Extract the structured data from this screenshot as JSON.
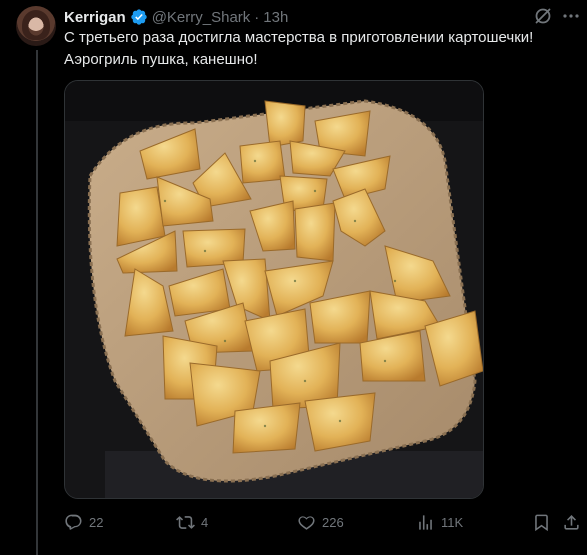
{
  "tweet": {
    "author_name": "Kerrigan",
    "author_handle": "@Kerry_Shark",
    "separator": "·",
    "time": "13h",
    "text": "С третьего раза достигла мастерства в приготовлении картошечки!\nАэрогриль пушка, канешно!",
    "media_alt": "photo"
  },
  "actions": {
    "replies": "22",
    "reposts": "4",
    "likes": "226",
    "views": "11K"
  },
  "icons": {
    "verified": "verified-badge-icon",
    "grok": "grok-icon",
    "more": "more-icon",
    "reply": "reply-icon",
    "repost": "repost-icon",
    "like": "heart-icon",
    "views": "views-icon",
    "bookmark": "bookmark-icon",
    "share": "share-icon"
  },
  "colors": {
    "background": "#000000",
    "text": "#e7e9ea",
    "muted": "#71767b",
    "verified": "#1d9bf0"
  }
}
